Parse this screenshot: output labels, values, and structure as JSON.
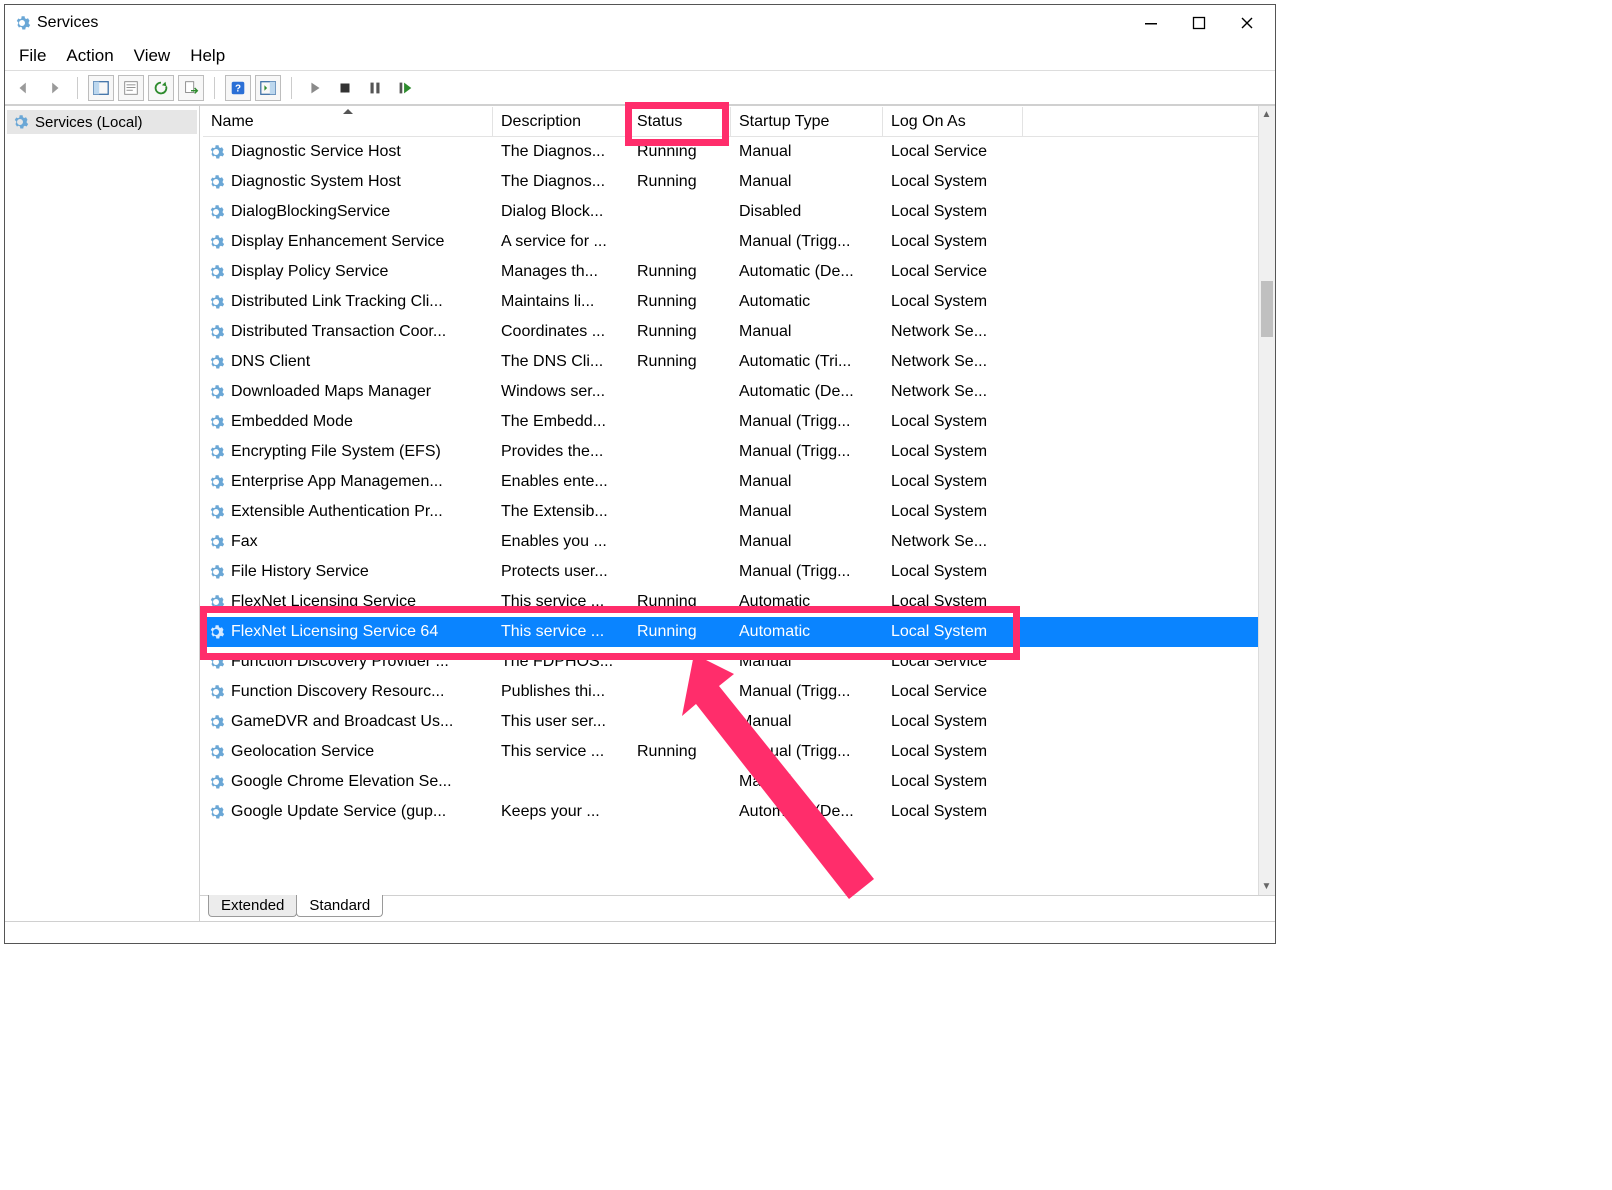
{
  "window": {
    "title": "Services"
  },
  "menu": {
    "file": "File",
    "action": "Action",
    "view": "View",
    "help": "Help"
  },
  "tree": {
    "root": "Services (Local)"
  },
  "columns": {
    "name": "Name",
    "description": "Description",
    "status": "Status",
    "startup": "Startup Type",
    "logon": "Log On As"
  },
  "tabs": {
    "extended": "Extended",
    "standard": "Standard"
  },
  "services": [
    {
      "name": "Diagnostic Service Host",
      "desc": "The Diagnos...",
      "status": "Running",
      "startup": "Manual",
      "logon": "Local Service"
    },
    {
      "name": "Diagnostic System Host",
      "desc": "The Diagnos...",
      "status": "Running",
      "startup": "Manual",
      "logon": "Local System"
    },
    {
      "name": "DialogBlockingService",
      "desc": "Dialog Block...",
      "status": "",
      "startup": "Disabled",
      "logon": "Local System"
    },
    {
      "name": "Display Enhancement Service",
      "desc": "A service for ...",
      "status": "",
      "startup": "Manual (Trigg...",
      "logon": "Local System"
    },
    {
      "name": "Display Policy Service",
      "desc": "Manages th...",
      "status": "Running",
      "startup": "Automatic (De...",
      "logon": "Local Service"
    },
    {
      "name": "Distributed Link Tracking Cli...",
      "desc": "Maintains li...",
      "status": "Running",
      "startup": "Automatic",
      "logon": "Local System"
    },
    {
      "name": "Distributed Transaction Coor...",
      "desc": "Coordinates ...",
      "status": "Running",
      "startup": "Manual",
      "logon": "Network Se..."
    },
    {
      "name": "DNS Client",
      "desc": "The DNS Cli...",
      "status": "Running",
      "startup": "Automatic (Tri...",
      "logon": "Network Se..."
    },
    {
      "name": "Downloaded Maps Manager",
      "desc": "Windows ser...",
      "status": "",
      "startup": "Automatic (De...",
      "logon": "Network Se..."
    },
    {
      "name": "Embedded Mode",
      "desc": "The Embedd...",
      "status": "",
      "startup": "Manual (Trigg...",
      "logon": "Local System"
    },
    {
      "name": "Encrypting File System (EFS)",
      "desc": "Provides the...",
      "status": "",
      "startup": "Manual (Trigg...",
      "logon": "Local System"
    },
    {
      "name": "Enterprise App Managemen...",
      "desc": "Enables ente...",
      "status": "",
      "startup": "Manual",
      "logon": "Local System"
    },
    {
      "name": "Extensible Authentication Pr...",
      "desc": "The Extensib...",
      "status": "",
      "startup": "Manual",
      "logon": "Local System"
    },
    {
      "name": "Fax",
      "desc": "Enables you ...",
      "status": "",
      "startup": "Manual",
      "logon": "Network Se..."
    },
    {
      "name": "File History Service",
      "desc": "Protects user...",
      "status": "",
      "startup": "Manual (Trigg...",
      "logon": "Local System"
    },
    {
      "name": "FlexNet Licensing Service",
      "desc": "This service ...",
      "status": "Running",
      "startup": "Automatic",
      "logon": "Local System"
    },
    {
      "name": "FlexNet Licensing Service 64",
      "desc": "This service ...",
      "status": "Running",
      "startup": "Automatic",
      "logon": "Local System",
      "selected": true
    },
    {
      "name": "Function Discovery Provider ...",
      "desc": "The FDPHOS...",
      "status": "",
      "startup": "Manual",
      "logon": "Local Service"
    },
    {
      "name": "Function Discovery Resourc...",
      "desc": "Publishes thi...",
      "status": "",
      "startup": "Manual (Trigg...",
      "logon": "Local Service"
    },
    {
      "name": "GameDVR and Broadcast Us...",
      "desc": "This user ser...",
      "status": "",
      "startup": "Manual",
      "logon": "Local System"
    },
    {
      "name": "Geolocation Service",
      "desc": "This service ...",
      "status": "Running",
      "startup": "Manual (Trigg...",
      "logon": "Local System"
    },
    {
      "name": "Google Chrome Elevation Se...",
      "desc": "",
      "status": "",
      "startup": "Manual",
      "logon": "Local System"
    },
    {
      "name": "Google Update Service (gup...",
      "desc": "Keeps your ...",
      "status": "",
      "startup": "Automatic (De...",
      "logon": "Local System"
    }
  ],
  "annotation": {
    "highlight_color": "#ff2d6b",
    "status_header_box": true,
    "selected_row_box": true
  }
}
